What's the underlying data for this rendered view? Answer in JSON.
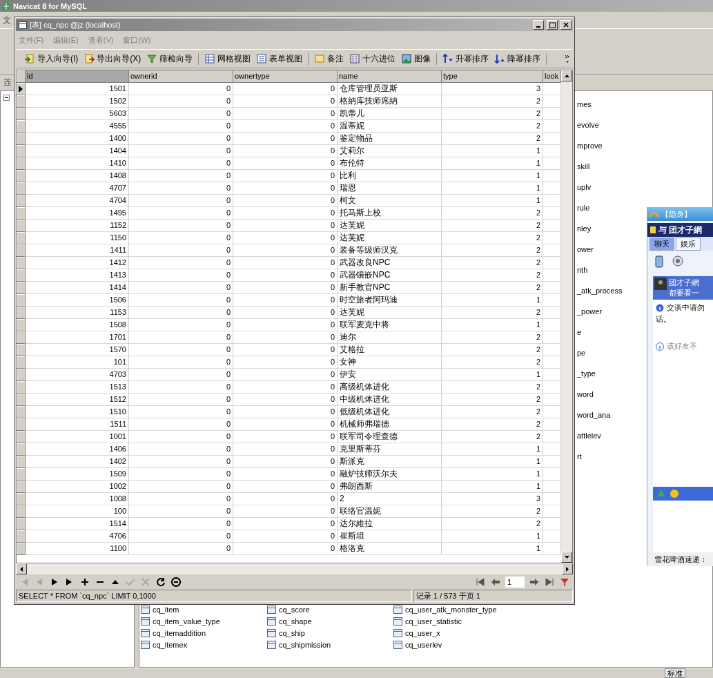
{
  "app": {
    "title": "Navicat 8 for MySQL",
    "menu_fragment": "文",
    "tab_fragment": "连"
  },
  "background_list": {
    "fragments": [
      "mes",
      "evolve",
      "mprove",
      "skill",
      "uplv",
      "rule",
      "nley",
      "ower",
      "nth",
      "_atk_process",
      "_power",
      "e",
      "pe",
      "_type",
      "word",
      "word_ana",
      "attlelev",
      "rt"
    ],
    "items": [
      "cq_item",
      "cq_item_value_type",
      "cq_itemaddition",
      "cq_itemex",
      "cq_score",
      "cq_shape",
      "cq_ship",
      "cq_shipmission",
      "cq_user_atk_monster_type",
      "cq_user_statistic",
      "cq_user_x",
      "cq_userlev"
    ]
  },
  "chat": {
    "status": "【隐身】",
    "header": "与 团才子網",
    "tabs": [
      {
        "label": "聊天",
        "selected": true
      },
      {
        "label": "娱乐",
        "selected": false
      }
    ],
    "banner": [
      "团才子網",
      "都要看一"
    ],
    "notice": [
      "交谈中请勿",
      "话。"
    ],
    "offline_notice": "该好友不",
    "footer": "雪花啤酒速递："
  },
  "taskbar": {
    "label": "标准"
  },
  "table_window": {
    "title": "[表] cq_npc @jz (localhost)",
    "menu": [
      "文件(F)",
      "编辑(E)",
      "查看(V)",
      "窗口(W)"
    ],
    "toolbar": [
      [
        {
          "label": "导入向导(I)"
        },
        {
          "label": "导出向导(X)"
        },
        {
          "label": "筛检向导"
        }
      ],
      [
        {
          "label": "网格视图"
        },
        {
          "label": "表单视图"
        }
      ],
      [
        {
          "label": "备注"
        },
        {
          "label": "十六进位"
        },
        {
          "label": "图像"
        }
      ],
      [
        {
          "label": "升幂排序"
        },
        {
          "label": "降幂排序"
        }
      ]
    ],
    "columns": [
      {
        "label": "id",
        "kind": "number",
        "selected": true
      },
      {
        "label": "ownerid",
        "kind": "number",
        "selected": false
      },
      {
        "label": "ownertype",
        "kind": "number",
        "selected": false
      },
      {
        "label": "name",
        "kind": "text",
        "selected": false
      },
      {
        "label": "type",
        "kind": "number",
        "selected": false
      },
      {
        "label": "look",
        "kind": "number",
        "selected": false
      }
    ],
    "rows": [
      {
        "cells": [
          "1501",
          "0",
          "0",
          "仓库管理员亚斯",
          "3"
        ],
        "selected": true
      },
      {
        "cells": [
          "1502",
          "0",
          "0",
          "格納库技师席納",
          "2"
        ],
        "selected": false
      },
      {
        "cells": [
          "5603",
          "0",
          "0",
          "凯蒂儿",
          "2"
        ],
        "selected": false
      },
      {
        "cells": [
          "4555",
          "0",
          "0",
          "温蒂妮",
          "2"
        ],
        "selected": false
      },
      {
        "cells": [
          "1400",
          "0",
          "0",
          "鉴定物品",
          "2"
        ],
        "selected": false
      },
      {
        "cells": [
          "1404",
          "0",
          "0",
          "艾莉尔",
          "1"
        ],
        "selected": false
      },
      {
        "cells": [
          "1410",
          "0",
          "0",
          "布伦特",
          "1"
        ],
        "selected": false
      },
      {
        "cells": [
          "1408",
          "0",
          "0",
          "比利",
          "1"
        ],
        "selected": false
      },
      {
        "cells": [
          "4707",
          "0",
          "0",
          "瑞恩",
          "1"
        ],
        "selected": false
      },
      {
        "cells": [
          "4704",
          "0",
          "0",
          "柯文",
          "1"
        ],
        "selected": false
      },
      {
        "cells": [
          "1495",
          "0",
          "0",
          "托马斯上校",
          "2"
        ],
        "selected": false
      },
      {
        "cells": [
          "1152",
          "0",
          "0",
          "达芙妮",
          "2"
        ],
        "selected": false
      },
      {
        "cells": [
          "1150",
          "0",
          "0",
          "达芙妮",
          "2"
        ],
        "selected": false
      },
      {
        "cells": [
          "1411",
          "0",
          "0",
          "装备等级师汉克",
          "2"
        ],
        "selected": false
      },
      {
        "cells": [
          "1412",
          "0",
          "0",
          "武器改良NPC",
          "2"
        ],
        "selected": false
      },
      {
        "cells": [
          "1413",
          "0",
          "0",
          "武器镶嵌NPC",
          "2"
        ],
        "selected": false
      },
      {
        "cells": [
          "1414",
          "0",
          "0",
          "新手教官NPC",
          "2"
        ],
        "selected": false
      },
      {
        "cells": [
          "1506",
          "0",
          "0",
          "时空旅者阿玛迪",
          "1"
        ],
        "selected": false
      },
      {
        "cells": [
          "1153",
          "0",
          "0",
          "达芙妮",
          "2"
        ],
        "selected": false
      },
      {
        "cells": [
          "1508",
          "0",
          "0",
          "联军麦克中将",
          "1"
        ],
        "selected": false
      },
      {
        "cells": [
          "1701",
          "0",
          "0",
          "迪尔",
          "2"
        ],
        "selected": false
      },
      {
        "cells": [
          "1570",
          "0",
          "0",
          "艾格拉",
          "2"
        ],
        "selected": false
      },
      {
        "cells": [
          "101",
          "0",
          "0",
          "女神",
          "2"
        ],
        "selected": false
      },
      {
        "cells": [
          "4703",
          "0",
          "0",
          "伊安",
          "1"
        ],
        "selected": false
      },
      {
        "cells": [
          "1513",
          "0",
          "0",
          "高级机体进化",
          "2"
        ],
        "selected": false
      },
      {
        "cells": [
          "1512",
          "0",
          "0",
          "中级机体进化",
          "2"
        ],
        "selected": false
      },
      {
        "cells": [
          "1510",
          "0",
          "0",
          "低级机体进化",
          "2"
        ],
        "selected": false
      },
      {
        "cells": [
          "1511",
          "0",
          "0",
          "机械师弗瑞德",
          "2"
        ],
        "selected": false
      },
      {
        "cells": [
          "1001",
          "0",
          "0",
          "联军司令理查德",
          "2"
        ],
        "selected": false
      },
      {
        "cells": [
          "1406",
          "0",
          "0",
          "克里斯蒂芬",
          "1"
        ],
        "selected": false
      },
      {
        "cells": [
          "1402",
          "0",
          "0",
          "斯派克",
          "1"
        ],
        "selected": false
      },
      {
        "cells": [
          "1509",
          "0",
          "0",
          "融炉技师沃尔夫",
          "1"
        ],
        "selected": false
      },
      {
        "cells": [
          "1002",
          "0",
          "0",
          "弗朗西斯",
          "1"
        ],
        "selected": false
      },
      {
        "cells": [
          "1008",
          "0",
          "0",
          "2",
          "3"
        ],
        "selected": false
      },
      {
        "cells": [
          "100",
          "0",
          "0",
          "联络官温妮",
          "2"
        ],
        "selected": false
      },
      {
        "cells": [
          "1514",
          "0",
          "0",
          "达尔維拉",
          "2"
        ],
        "selected": false
      },
      {
        "cells": [
          "4706",
          "0",
          "0",
          "崔斯坦",
          "1"
        ],
        "selected": false
      },
      {
        "cells": [
          "1100",
          "0",
          "0",
          "格洛克",
          "1"
        ],
        "selected": false
      }
    ],
    "nav_buttons": [
      {
        "disabled": true
      },
      {
        "disabled": true
      },
      {
        "disabled": false
      },
      {
        "disabled": false
      },
      {
        "disabled": false
      },
      {
        "disabled": false
      },
      {
        "disabled": false
      },
      {
        "disabled": true
      },
      {
        "disabled": true
      },
      {
        "disabled": false
      },
      {
        "disabled": false
      }
    ],
    "page": "1",
    "status_sql": "SELECT * FROM `cq_npc` LIMIT 0,1000",
    "status_records": "记录 1 / 573 于页 1"
  }
}
